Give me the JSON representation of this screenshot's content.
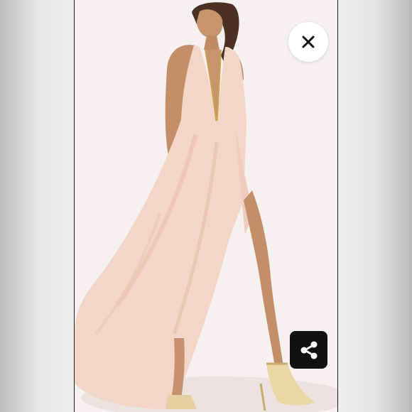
{
  "viewer": {
    "close_icon": "close-icon",
    "share_icon": "share-icon"
  },
  "colors": {
    "backdrop": "#eeeeee",
    "photo_background": "#f5f1f0",
    "dress": "#f3d6c8",
    "share_button": "#111111",
    "close_button": "#ffffff"
  }
}
